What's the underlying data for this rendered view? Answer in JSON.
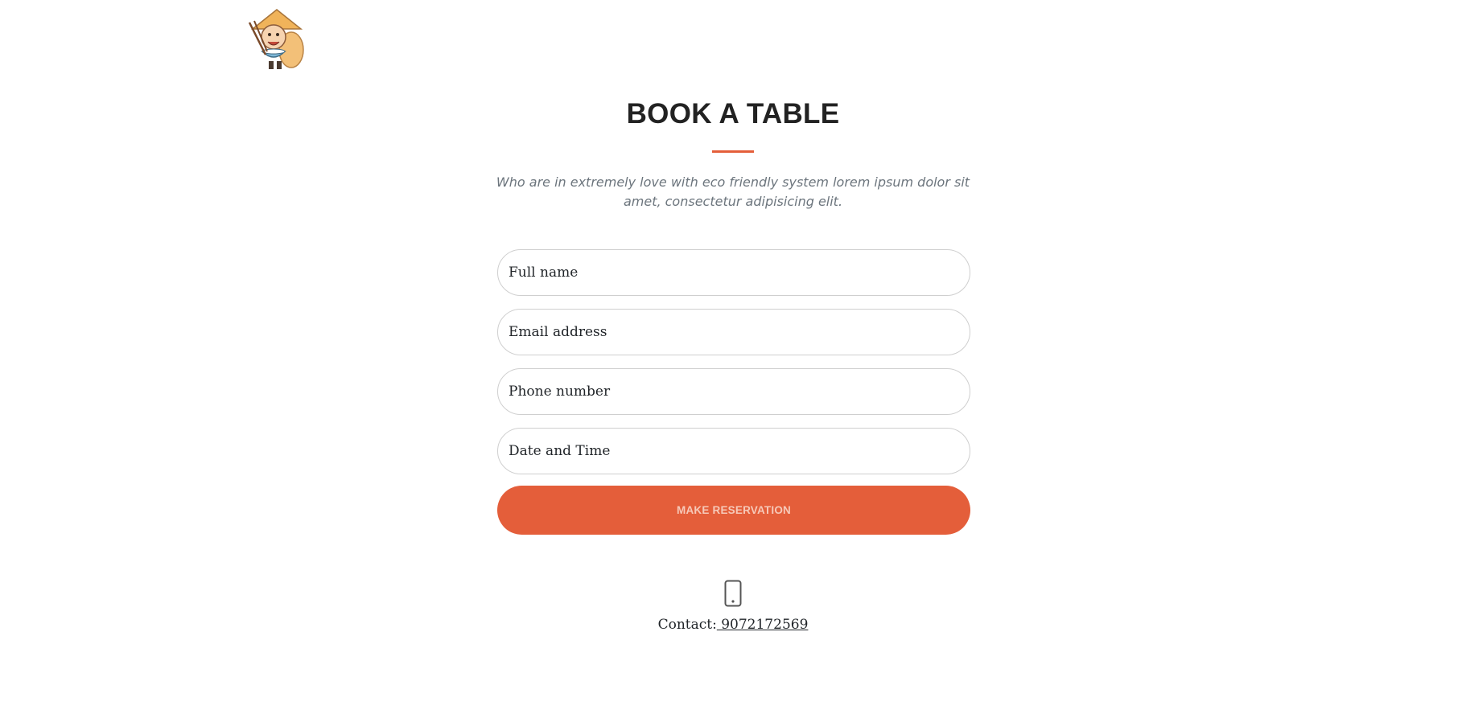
{
  "logo": {
    "icon": "chef-mascot-icon"
  },
  "booking": {
    "title": "BOOK A TABLE",
    "subtitle": "Who are in extremely love with eco friendly system lorem ipsum dolor sit amet, consectetur adipisicing elit.",
    "fields": {
      "full_name": {
        "placeholder": "Full name",
        "value": ""
      },
      "email": {
        "placeholder": "Email address",
        "value": ""
      },
      "phone": {
        "placeholder": "Phone number",
        "value": ""
      },
      "datetime": {
        "placeholder": "Date and Time",
        "value": ""
      }
    },
    "submit_label": "MAKE RESERVATION"
  },
  "contact": {
    "icon": "mobile-phone-icon",
    "label": "Contact:",
    "phone": " 9072172569"
  },
  "colors": {
    "accent": "#e45e3a",
    "text": "#212529",
    "muted": "#6c757d",
    "border": "#cfcfcf"
  }
}
